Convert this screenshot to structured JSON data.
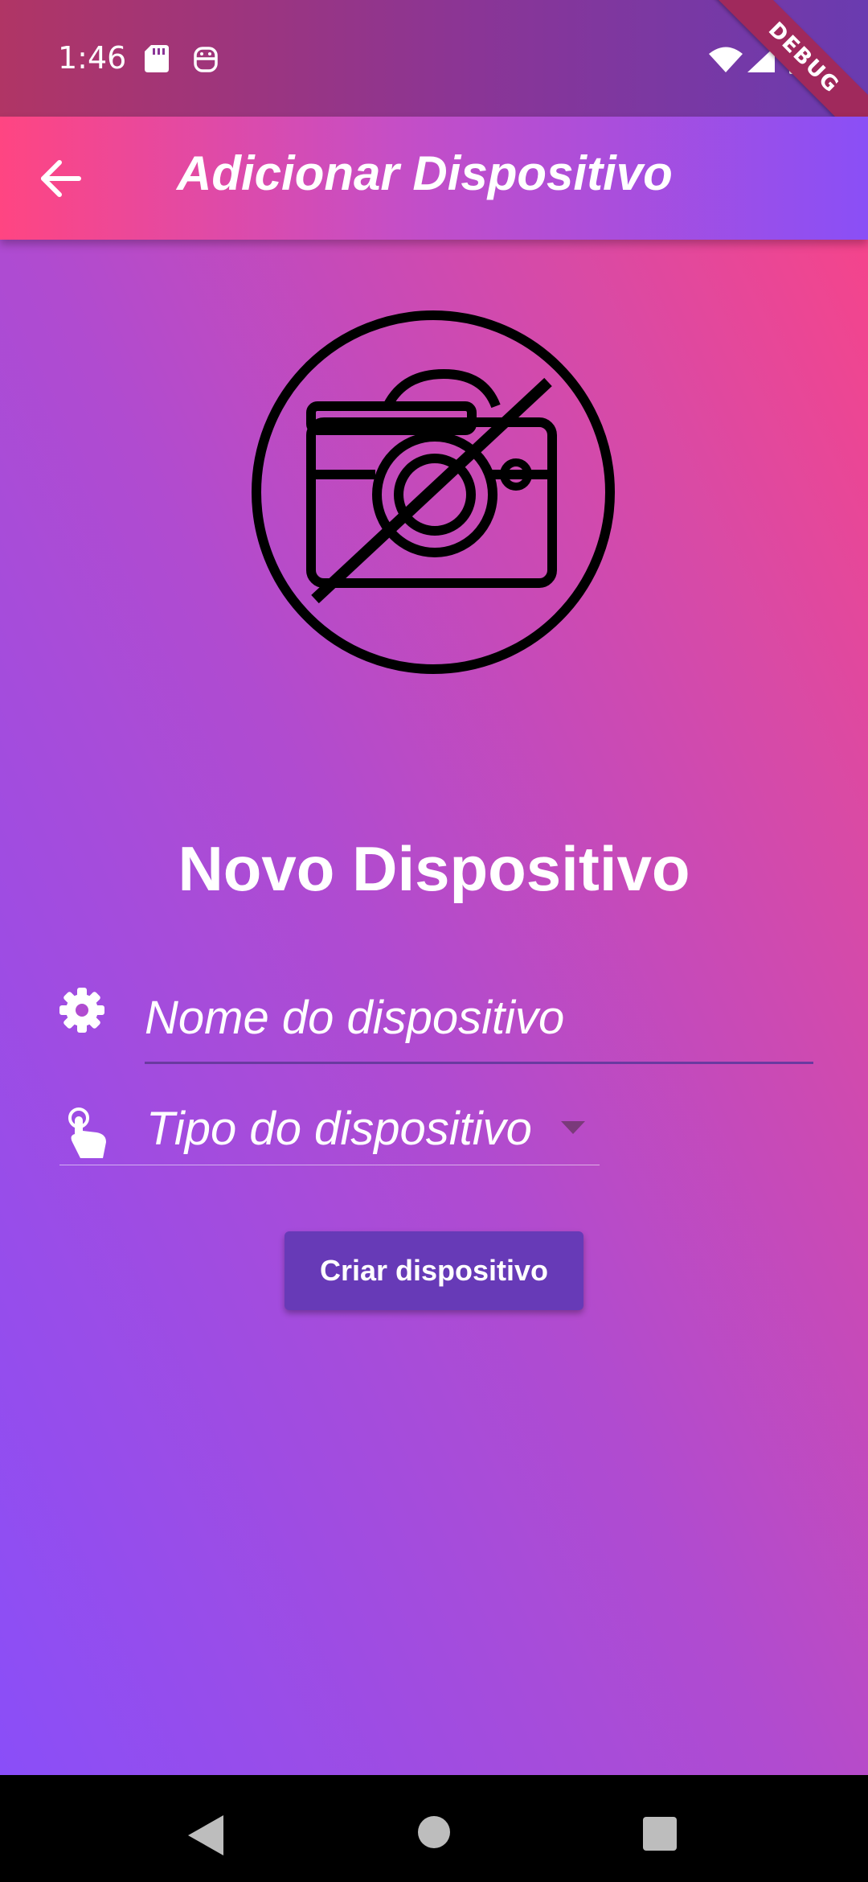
{
  "status_bar": {
    "time": "1:46",
    "icons": [
      "sd-card-icon",
      "android-robot-icon",
      "wifi-icon",
      "signal-icon",
      "battery-icon"
    ]
  },
  "debug_banner": "DEBUG",
  "app_bar": {
    "title": "Adicionar Dispositivo",
    "back_icon": "arrow-left-icon"
  },
  "main": {
    "illustration": "camera-off-icon",
    "heading": "Novo Dispositivo",
    "name_field": {
      "placeholder": "Nome do dispositivo",
      "value": "",
      "icon": "gear-icon"
    },
    "type_dropdown": {
      "label": "Tipo do dispositivo",
      "icon": "touch-icon"
    },
    "create_button": "Criar dispositivo"
  },
  "nav_bar": {
    "icons": [
      "nav-back-icon",
      "nav-home-icon",
      "nav-recents-icon"
    ]
  },
  "colors": {
    "gradient_top_right": "#ff4282",
    "gradient_bottom_left": "#8a4ef8",
    "button": "#673ab7",
    "text": "#ffffff"
  }
}
